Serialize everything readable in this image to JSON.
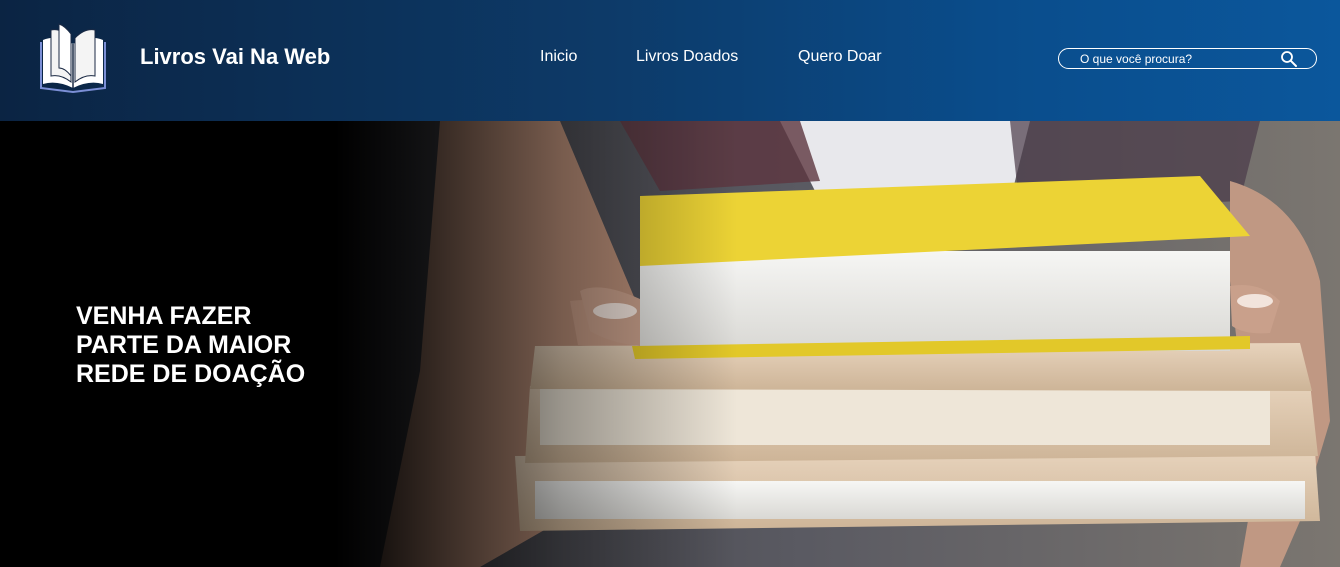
{
  "header": {
    "brand": "Livros Vai Na Web",
    "nav": [
      {
        "label": "Inicio"
      },
      {
        "label": "Livros Doados"
      },
      {
        "label": "Quero Doar"
      }
    ],
    "search": {
      "placeholder": "O que você procura?",
      "icon": "search-icon"
    },
    "logo_icon": "open-book-icon"
  },
  "hero": {
    "title": "VENHA FAZER\nPARTE DA MAIOR\nREDE DE DOAÇÃO",
    "image": "hands-holding-stack-of-books"
  },
  "colors": {
    "header_dark": "#0b2443",
    "header_light": "#0b579c",
    "hero_bg": "#000000",
    "book_yellow": "#ecd335"
  }
}
